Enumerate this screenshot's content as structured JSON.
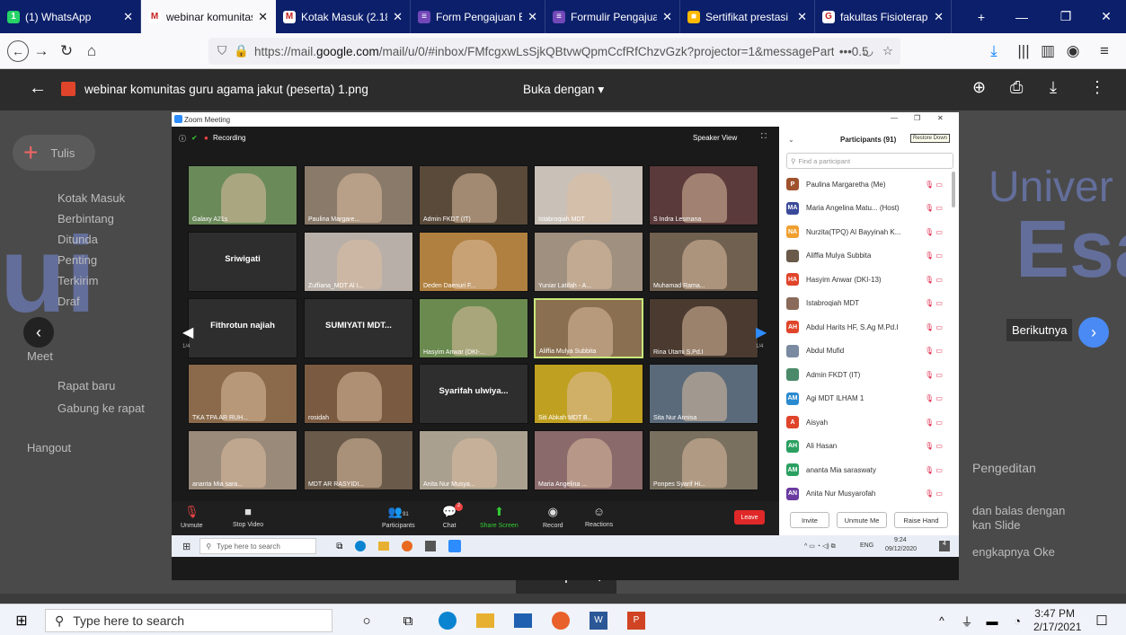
{
  "browser": {
    "tabs": [
      {
        "title": "(1) WhatsApp",
        "icon_color": "#25d366",
        "icon": "whatsapp-icon",
        "glyph": "1"
      },
      {
        "title": "webinar komunitas",
        "icon_color": "#ffffff",
        "icon": "gmail-icon",
        "glyph": "M",
        "active": true
      },
      {
        "title": "Kotak Masuk (2.188",
        "icon_color": "#ffffff",
        "icon": "gmail-icon",
        "glyph": "M"
      },
      {
        "title": "Form Pengajuan BK",
        "icon_color": "#7248b9",
        "icon": "forms-icon",
        "glyph": "≡"
      },
      {
        "title": "Formulir Pengajuan",
        "icon_color": "#7248b9",
        "icon": "forms-icon",
        "glyph": "≡"
      },
      {
        "title": "Sertifikat prestasi ka",
        "icon_color": "#ffb900",
        "icon": "microsoft-icon",
        "glyph": "■"
      },
      {
        "title": "fakultas Fisioterapi",
        "icon_color": "#ffffff",
        "icon": "google-icon",
        "glyph": "G"
      }
    ],
    "url_prefix": "https://mail.",
    "url_domain": "google.com",
    "url_rest": "/mail/u/0/#inbox/FMfcgxwLsSjkQBtvwQpmCcfRfChzvGzk?projector=1&messagePartId=0.5",
    "url_more": "•••"
  },
  "viewer": {
    "filename": "webinar komunitas guru agama jakut (peserta) 1.png",
    "open_with": "Buka dengan",
    "next_label": "Berikutnya"
  },
  "gmail_bg": {
    "compose": "Tulis",
    "items": [
      "Kotak Masuk",
      "Berbintang",
      "Ditunda",
      "Penting",
      "Terkirim",
      "Draf"
    ],
    "meet": "Meet",
    "meet_items": [
      "Rapat baru",
      "Gabung ke rapat"
    ],
    "hangout": "Hangout",
    "right_texts": [
      "Pengeditan",
      "dan balas dengan",
      "kan Slide",
      "engkapnya",
      "Oke"
    ]
  },
  "zoom": {
    "window_title": "Zoom Meeting",
    "recording": "Recording",
    "speaker_view": "Speaker View",
    "page_left": "1/4",
    "page_right": "1/4",
    "tiles": [
      {
        "name": "Galaxy A21s",
        "color": "#6b8a5a"
      },
      {
        "name": "Paulina Margare...",
        "color": "#8a7a6a"
      },
      {
        "name": "Admin FKDT (IT)",
        "color": "#5a4a3a"
      },
      {
        "name": "Istabroqiah MDT",
        "color": "#c9c0b8"
      },
      {
        "name": "S Indra Lesmana",
        "color": "#5a3a3a"
      },
      {
        "name": "",
        "center": "Sriwigati",
        "color": "#333333"
      },
      {
        "name": "Zulfiana_MDT Al I...",
        "color": "#b8b0a8"
      },
      {
        "name": "Deden Daenuri F...",
        "color": "#b08040"
      },
      {
        "name": "Yuniar Latifah - A...",
        "color": "#a09080"
      },
      {
        "name": "Muhamad Rama...",
        "color": "#706050"
      },
      {
        "name": "",
        "center": "Fithrotun najiah",
        "color": "#333333"
      },
      {
        "name": "",
        "center": "SUMIYATI MDT...",
        "color": "#333333"
      },
      {
        "name": "Hasyim Anwar (DKI-...",
        "color": "#6a8a50"
      },
      {
        "name": "Aliffia Mulya Subbita",
        "color": "#8a7050"
      },
      {
        "name": "Rina Utami S.Pd.I",
        "color": "#4a3a30"
      },
      {
        "name": "TKA TPA AR RUH...",
        "color": "#8a6a4a"
      },
      {
        "name": "rosidah",
        "color": "#7a5a40"
      },
      {
        "name": "",
        "center": "Syarifah ulwiya...",
        "color": "#333333"
      },
      {
        "name": "Siti Abkah MDT B...",
        "color": "#c0a020"
      },
      {
        "name": "Sita Nur Annisa",
        "color": "#5a6a7a"
      },
      {
        "name": "ananta Mia sara...",
        "color": "#9a8a7a"
      },
      {
        "name": "MDT AR RASYIDI...",
        "color": "#6a5a4a"
      },
      {
        "name": "Anita Nur Musya...",
        "color": "#aaa090"
      },
      {
        "name": "Maria Angelina ...",
        "color": "#8a6a6a"
      },
      {
        "name": "Ponpes Syarif Hi...",
        "color": "#7a7060"
      }
    ],
    "controls": {
      "unmute": "Unmute",
      "stop_video": "Stop Video",
      "participants": "Participants",
      "participants_count": "91",
      "chat": "Chat",
      "chat_badge": "2",
      "share": "Share Screen",
      "record": "Record",
      "reactions": "Reactions",
      "leave": "Leave"
    },
    "participants_title": "Participants (91)",
    "restore": "Restore Down",
    "find_placeholder": "Find a participant",
    "participants": [
      {
        "initials": "P",
        "color": "#a0522d",
        "name": "Paulina Margaretha (Me)"
      },
      {
        "initials": "MA",
        "color": "#3a4a9a",
        "name": "Maria Angelina Matu... (Host)"
      },
      {
        "initials": "NA",
        "color": "#f0a030",
        "name": "Nurzita(TPQ) Al Bayyinah K..."
      },
      {
        "initials": "",
        "color": "#6a5a4a",
        "name": "Aliffia Mulya Subbita"
      },
      {
        "initials": "HA",
        "color": "#e0442a",
        "name": "Hasyim Anwar (DKI-13)"
      },
      {
        "initials": "",
        "color": "#8a6a5a",
        "name": "Istabroqiah MDT"
      },
      {
        "initials": "AH",
        "color": "#e0442a",
        "name": "Abdul Harits HF, S.Ag M.Pd.I"
      },
      {
        "initials": "",
        "color": "#7a8aa0",
        "name": "Abdul Mufid"
      },
      {
        "initials": "",
        "color": "#4a8a6a",
        "name": "Admin FKDT (IT)"
      },
      {
        "initials": "AM",
        "color": "#2a8ad0",
        "name": "Agi MDT ILHAM 1"
      },
      {
        "initials": "A",
        "color": "#e0442a",
        "name": "Aisyah"
      },
      {
        "initials": "AH",
        "color": "#2aa060",
        "name": "Ali Hasan"
      },
      {
        "initials": "AM",
        "color": "#2aa060",
        "name": "ananta Mia saraswaty"
      },
      {
        "initials": "AN",
        "color": "#6a3aa0",
        "name": "Anita Nur Musyarofah"
      }
    ],
    "invite": "Invite",
    "unmute_me": "Unmute Me",
    "raise_hand": "Raise Hand",
    "inner_search": "Type here to search",
    "inner_time": "9:24",
    "inner_date": "09/12/2020",
    "inner_lang": "ENG",
    "inner_notif": "4"
  },
  "taskbar": {
    "search": "Type here to search",
    "time": "3:47 PM",
    "date": "2/17/2021"
  }
}
